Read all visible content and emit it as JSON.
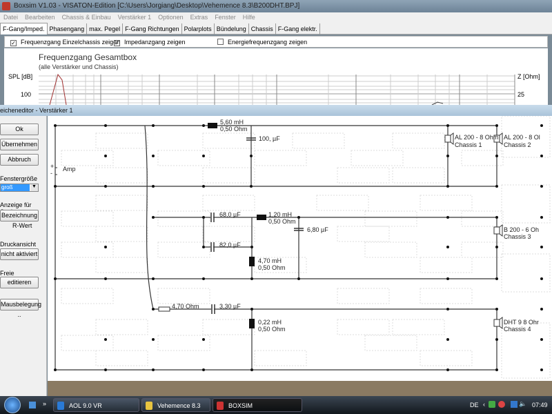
{
  "window": {
    "title": "Boxsim V1.03 - VISATON-Edition [C:\\Users\\Jorgiang\\Desktop\\Vehemence 8.3\\B200DHT.BPJ]"
  },
  "menu": [
    "Datei",
    "Bearbeiten",
    "Chassis & Einbau",
    "Verstärker 1",
    "Optionen",
    "Extras",
    "Fenster",
    "Hilfe"
  ],
  "tabs": [
    "F-Gang/Imped.",
    "Phasengang",
    "max. Pegel",
    "F-Gang Richtungen",
    "Polarplots",
    "Bündelung",
    "Chassis",
    "F-Gang elektr."
  ],
  "checks": [
    {
      "label": "Frequenzgang Einzelchassis zeigen",
      "checked": true
    },
    {
      "label": "Impedanzgang zeigen",
      "checked": true
    },
    {
      "label": "Energiefrequenzgang zeigen",
      "checked": false
    }
  ],
  "chart": {
    "title": "Frequenzgang Gesamtbox",
    "subtitle": "(alle Verstärker und Chassis)",
    "ylabel_left": "SPL [dB]",
    "ylabel_right": "Z [Ohm]",
    "tick_left": "100",
    "tick_right": "25"
  },
  "dialog": {
    "title": "eicheneditor - Verstärker 1",
    "ok": "Ok",
    "apply": "Übernehmen",
    "cancel": "Abbruch",
    "size_label": "Fenstergröße",
    "size_value": "groß",
    "coil_label": "Anzeige für Spulen",
    "coil_button": "Bezeichnung",
    "coil_value": "R-Wert",
    "print_label": "Druckansicht",
    "print_button": "nicht aktiviert",
    "free_label": "Freie Verbindungen",
    "free_button": "editieren",
    "mouse_button": "Mausbelegung .."
  },
  "circuit": {
    "amp": "Amp",
    "amp_plus": "+",
    "amp_minus": "-",
    "L1": [
      "5,60 mH",
      "0,50 Ohm"
    ],
    "C1": "100, µF",
    "C2": "68,0 µF",
    "L2": [
      "1,20 mH",
      "0,50 Ohm"
    ],
    "C3": "6,80 µF",
    "C4": "82,0 µF",
    "L3": [
      "4,70 mH",
      "0,50 Ohm"
    ],
    "R1": "4,70 Ohm",
    "C5": "3,30 µF",
    "L4": [
      "0,22 mH",
      "0,50 Ohm"
    ],
    "speakers": [
      [
        "AL 200 - 8 Ohm",
        "Chassis 1"
      ],
      [
        "AL 200 - 8 Ol",
        "Chassis 2"
      ],
      [
        "B 200 - 6 Oh",
        "Chassis 3"
      ],
      [
        "DHT 9 8 Ohr",
        "Chassis 4"
      ]
    ]
  },
  "taskbar": {
    "items": [
      "AOL 9.0 VR",
      "Vehemence 8.3",
      "BOXSIM"
    ],
    "lang": "DE",
    "time": "07:49",
    "more": "»"
  }
}
